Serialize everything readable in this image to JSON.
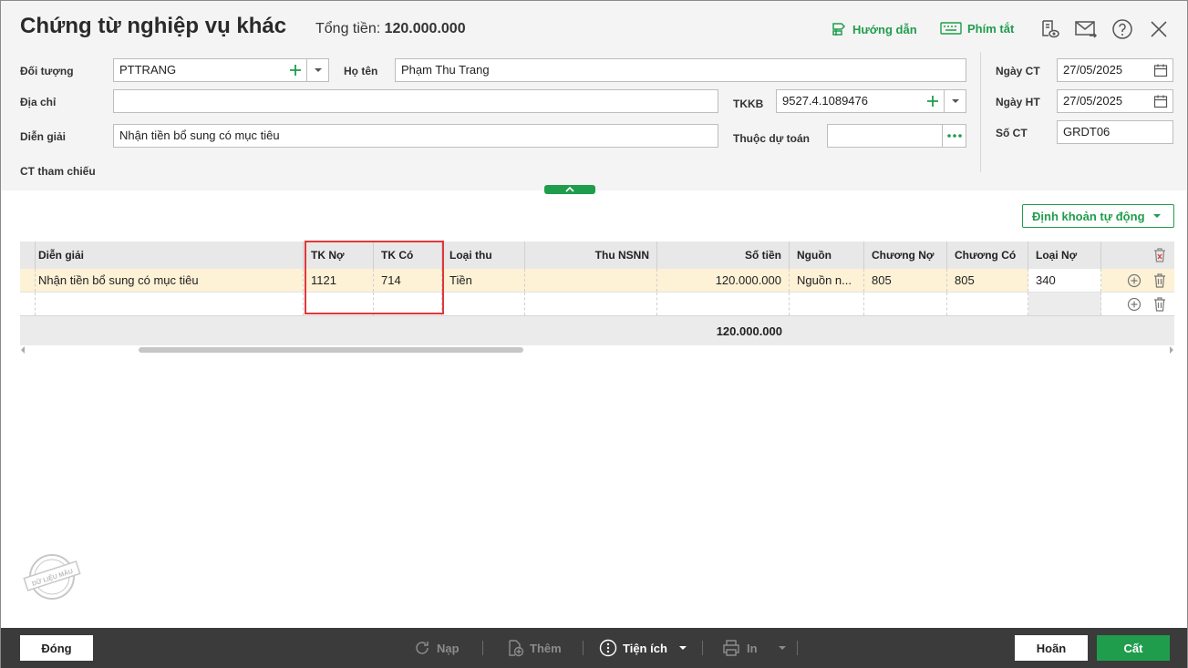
{
  "header": {
    "title": "Chứng từ nghiệp vụ khác",
    "total_label": "Tổng tiền:",
    "total_value": "120.000.000",
    "guide_label": "Hướng dẫn",
    "shortcut_label": "Phím tắt"
  },
  "form": {
    "doi_tuong_label": "Đối tượng",
    "doi_tuong_value": "PTTRANG",
    "ho_ten_label": "Họ tên",
    "ho_ten_value": "Phạm Thu Trang",
    "dia_chi_label": "Địa chỉ",
    "dia_chi_value": "",
    "tkkb_label": "TKKB",
    "tkkb_value": "9527.4.1089476",
    "dien_giai_label": "Diễn giải",
    "dien_giai_value": "Nhận tiền bổ sung có mục tiêu",
    "thuoc_du_toan_label": "Thuộc dự toán",
    "thuoc_du_toan_value": "",
    "ct_tham_chieu_label": "CT tham chiếu",
    "ngay_ct_label": "Ngày CT",
    "ngay_ct_value": "27/05/2025",
    "ngay_ht_label": "Ngày HT",
    "ngay_ht_value": "27/05/2025",
    "so_ct_label": "Số CT",
    "so_ct_value": "GRDT06"
  },
  "auto_button_label": "Định khoản tự động",
  "grid": {
    "columns": [
      "Diễn giải",
      "TK Nợ",
      "TK Có",
      "Loại thu",
      "Thu NSNN",
      "Số tiền",
      "Nguồn",
      "Chương Nợ",
      "Chương Có",
      "Loại Nợ"
    ],
    "rows": [
      [
        "Nhận tiền bổ sung có mục tiêu",
        "1121",
        "714",
        "Tiền",
        "",
        "120.000.000",
        "Nguồn n...",
        "805",
        "805",
        "340"
      ]
    ],
    "total": "120.000.000"
  },
  "watermark_text": "DỮ LIỆU MẪU",
  "footer": {
    "close_label": "Đóng",
    "reload_label": "Nạp",
    "add_label": "Thêm",
    "utility_label": "Tiện ích",
    "print_label": "In",
    "cancel_label": "Hoãn",
    "save_label": "Cất"
  },
  "colors": {
    "accent": "#1f9d4c",
    "highlight_row": "#fdf1d6",
    "annotation_box": "#e0383b",
    "footer_bg": "#3b3b3b"
  }
}
